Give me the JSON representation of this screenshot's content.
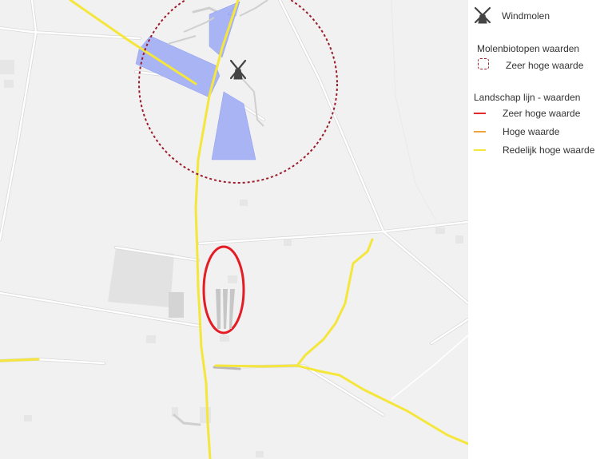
{
  "legend": {
    "windmill_label": "Windmolen",
    "biotope_title": "Molenbiotopen waarden",
    "biotope_item": "Zeer hoge waarde",
    "landscape_title": "Landschap lijn - waarden",
    "landscape_items": [
      {
        "label": "Zeer hoge waarde",
        "color": "#e8282d"
      },
      {
        "label": "Hoge waarde",
        "color": "#f2a33a"
      },
      {
        "label": "Redelijk hoge waarde",
        "color": "#f4e63a"
      }
    ]
  },
  "colors": {
    "map_background": "#f1f1f1",
    "road": "#ffffff",
    "road_casing": "#d8d8d8",
    "landscape_line": "#f4e63a",
    "built_area": "#a9b4f5",
    "biotope_circle": "#9c1c2c",
    "highlight_ellipse": "#e41c24"
  },
  "map": {
    "icons": [
      "windmill-icon"
    ],
    "features": [
      "molenbiotoop-circle",
      "built-area",
      "landscape-lines",
      "highlight-ellipse"
    ]
  }
}
